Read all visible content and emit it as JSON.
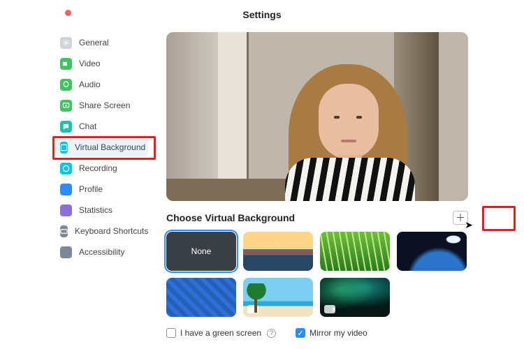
{
  "window": {
    "title": "Settings"
  },
  "sidebar": {
    "items": [
      {
        "label": "General",
        "icon": "gear-icon",
        "color": "c-gray"
      },
      {
        "label": "Video",
        "icon": "video-icon",
        "color": "c-green"
      },
      {
        "label": "Audio",
        "icon": "audio-icon",
        "color": "c-green"
      },
      {
        "label": "Share Screen",
        "icon": "share-icon",
        "color": "c-green"
      },
      {
        "label": "Chat",
        "icon": "chat-icon",
        "color": "c-teal"
      },
      {
        "label": "Virtual Background",
        "icon": "vb-icon",
        "color": "c-cyan"
      },
      {
        "label": "Recording",
        "icon": "recording-icon",
        "color": "c-cyan"
      },
      {
        "label": "Profile",
        "icon": "profile-icon",
        "color": "c-blue"
      },
      {
        "label": "Statistics",
        "icon": "stats-icon",
        "color": "c-purple"
      },
      {
        "label": "Keyboard Shortcuts",
        "icon": "keyboard-icon",
        "color": "c-slate"
      },
      {
        "label": "Accessibility",
        "icon": "accessibility-icon",
        "color": "c-slate"
      }
    ],
    "selected_index": 5
  },
  "main": {
    "section_title": "Choose Virtual Background",
    "thumbs": [
      {
        "label": "None",
        "kind": "none",
        "selected": true,
        "video": false
      },
      {
        "label": "",
        "kind": "bridge",
        "selected": false,
        "video": false
      },
      {
        "label": "",
        "kind": "grass",
        "selected": false,
        "video": false
      },
      {
        "label": "",
        "kind": "earth",
        "selected": false,
        "video": false
      },
      {
        "label": "",
        "kind": "blue",
        "selected": false,
        "video": false
      },
      {
        "label": "",
        "kind": "beach",
        "selected": false,
        "video": true
      },
      {
        "label": "",
        "kind": "aurora",
        "selected": false,
        "video": true
      }
    ],
    "green_screen_label": "I have a green screen",
    "green_screen_checked": false,
    "mirror_label": "Mirror my video",
    "mirror_checked": true
  },
  "annotations": {
    "nav_highlight_index": 5,
    "add_button_highlight": true
  }
}
